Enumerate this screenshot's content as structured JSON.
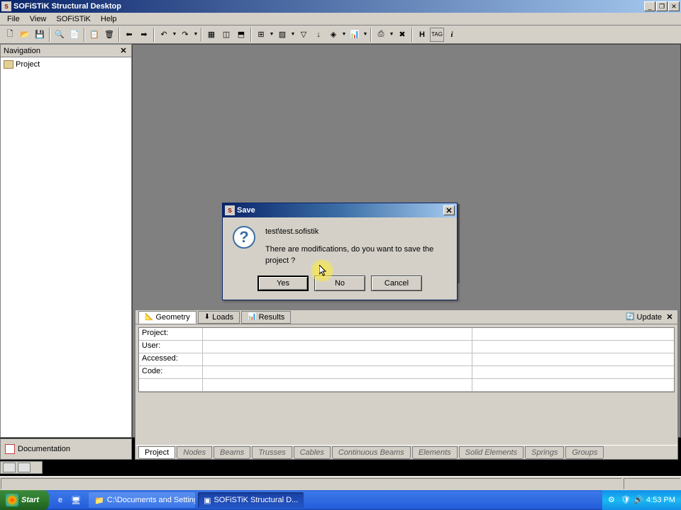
{
  "window": {
    "title": "SOFiSTiK Structural Desktop"
  },
  "menu": {
    "file": "File",
    "view": "View",
    "sofistik": "SOFiSTiK",
    "help": "Help"
  },
  "nav": {
    "title": "Navigation",
    "project": "Project"
  },
  "dialog": {
    "title": "Save",
    "file": "test\\test.sofistik",
    "message": "There are modifications, do you want to save the project ?",
    "yes": "Yes",
    "no": "No",
    "cancel": "Cancel"
  },
  "bottom_panel": {
    "tabs": {
      "geometry": "Geometry",
      "loads": "Loads",
      "results": "Results"
    },
    "update": "Update",
    "rows": {
      "project": "Project:",
      "user": "User:",
      "accessed": "Accessed:",
      "code": "Code:"
    }
  },
  "bottom_tabs": [
    "Project",
    "Nodes",
    "Beams",
    "Trusses",
    "Cables",
    "Continuous Beams",
    "Elements",
    "Solid Elements",
    "Springs",
    "Groups"
  ],
  "doc_panel": "Documentation",
  "taskbar": {
    "start": "Start",
    "tasks": [
      "C:\\Documents and Setting...",
      "SOFiSTiK Structural D..."
    ],
    "time": "4:53 PM"
  }
}
